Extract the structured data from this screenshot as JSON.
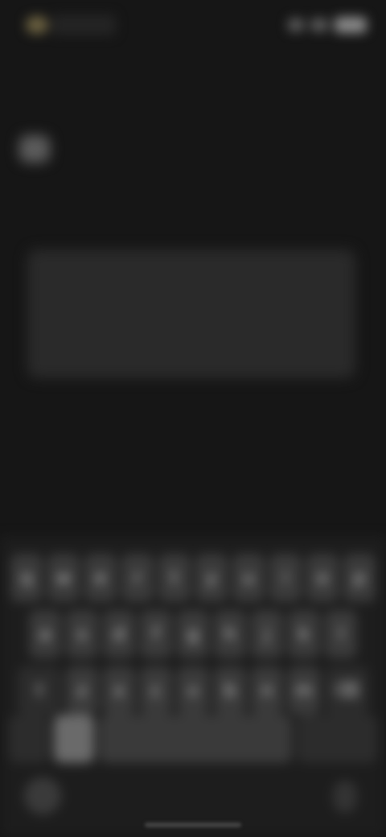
{
  "colors": {
    "background": "#161616",
    "keyboard": "#1d1d1d",
    "key": "#3a3a3a",
    "accent": "#6a6040"
  },
  "status_bar": {
    "icons": [
      "status-dot-icon",
      "signal-icon",
      "wifi-icon",
      "battery-icon"
    ]
  },
  "page": {
    "icon": "app-icon",
    "prompt": "",
    "text_box_value": ""
  },
  "keyboard": {
    "row1": [
      "q",
      "w",
      "e",
      "r",
      "t",
      "y",
      "u",
      "i",
      "o",
      "p"
    ],
    "row2": [
      "a",
      "s",
      "d",
      "f",
      "g",
      "h",
      "j",
      "k",
      "l"
    ],
    "row3": [
      "⇧",
      "z",
      "x",
      "c",
      "v",
      "b",
      "n",
      "m",
      "⌫"
    ],
    "row4": {
      "numbers": "",
      "emoji": "",
      "space": "",
      "return": ""
    },
    "bottom": {
      "globe": "",
      "mic": ""
    }
  }
}
